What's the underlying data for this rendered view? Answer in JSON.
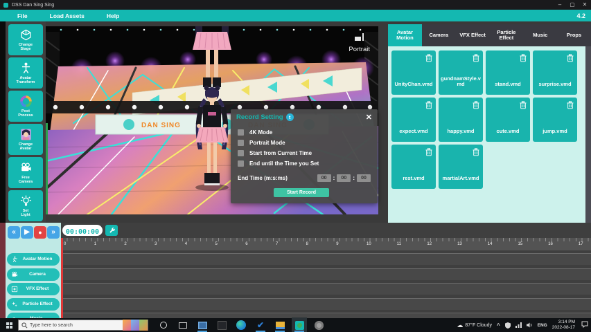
{
  "window": {
    "title": "DSS Dan Sing Sing"
  },
  "titlebar": {
    "minimize": "–",
    "maximize": "▢",
    "close": "✕"
  },
  "menubar": {
    "items": [
      "File",
      "Load Assets",
      "Help"
    ],
    "version": "4.2"
  },
  "sidebar": {
    "buttons": [
      {
        "label": "Change Stage",
        "icon": "stage-cube-icon"
      },
      {
        "label": "Avatar Transform",
        "icon": "avatar-transform-icon"
      },
      {
        "label": "Post Process",
        "icon": "post-process-icon"
      },
      {
        "label": "Change Avatar",
        "icon": "change-avatar-icon"
      },
      {
        "label": "Free Camera",
        "icon": "free-camera-icon"
      },
      {
        "label": "Set Light",
        "icon": "set-light-icon"
      }
    ]
  },
  "viewport": {
    "portrait_label": "Portrait",
    "stage_banner": "DAN SING"
  },
  "record_dialog": {
    "title": "Record Setting",
    "badge": "t",
    "close": "✕",
    "checkboxes": [
      {
        "label": "4K Mode",
        "checked": false
      },
      {
        "label": "Portrait Mode",
        "checked": false
      },
      {
        "label": "Start from Current Time",
        "checked": false
      },
      {
        "label": "End until the Time you Set",
        "checked": false
      }
    ],
    "end_time_label": "End Time (m:s:ms)",
    "end_time_values": [
      "00",
      "00",
      "00"
    ],
    "start_record_label": "Start Record"
  },
  "right_panel": {
    "tabs": [
      {
        "label": "Avatar Motion",
        "active": true
      },
      {
        "label": "Camera",
        "active": false
      },
      {
        "label": "VFX Effect",
        "active": false
      },
      {
        "label": "Particle Effect",
        "active": false
      },
      {
        "label": "Music",
        "active": false
      },
      {
        "label": "Props",
        "active": false
      }
    ],
    "cards": [
      "UnityChan.vmd",
      "gundnamStyle.vmd",
      "stand.vmd",
      "surprise.vmd",
      "expect.vmd",
      "happy.vmd",
      "cute.vmd",
      "jump.vmd",
      "rest.vmd",
      "martialArt.vmd"
    ]
  },
  "timeline": {
    "time_display": "00:00:00",
    "transport": [
      {
        "name": "skip-back-button",
        "glyph": "«"
      },
      {
        "name": "play-button",
        "glyph": "▶"
      },
      {
        "name": "record-button",
        "glyph": "●"
      },
      {
        "name": "skip-forward-button",
        "glyph": "»"
      }
    ],
    "ruler_ticks": [
      "0",
      "1",
      "2",
      "3",
      "4",
      "5",
      "6",
      "7",
      "8",
      "9",
      "10",
      "11",
      "12",
      "13",
      "14",
      "15",
      "16",
      "17"
    ],
    "tracks": [
      {
        "label": "Avatar Motion",
        "icon": "avatar-motion-icon"
      },
      {
        "label": "Camera",
        "icon": "camera-icon"
      },
      {
        "label": "VFX Effect",
        "icon": "vfx-effect-icon"
      },
      {
        "label": "Particle Effect",
        "icon": "particle-effect-icon"
      },
      {
        "label": "Music",
        "icon": "music-icon"
      }
    ]
  },
  "taskbar": {
    "search_placeholder": "Type here to search",
    "tray": {
      "weather": "87°F Cloudy",
      "language": "ENG",
      "time": "3:14 PM",
      "date": "2022-08-17"
    }
  },
  "colors": {
    "accent": "#14b8b1",
    "card": "#19b4ad",
    "panel_mint": "#cdf2ec",
    "record_red": "#e24444",
    "transport_blue": "#45a5e6",
    "start_record": "#3ec3a3",
    "timeline_left": "#bfe9e5"
  }
}
